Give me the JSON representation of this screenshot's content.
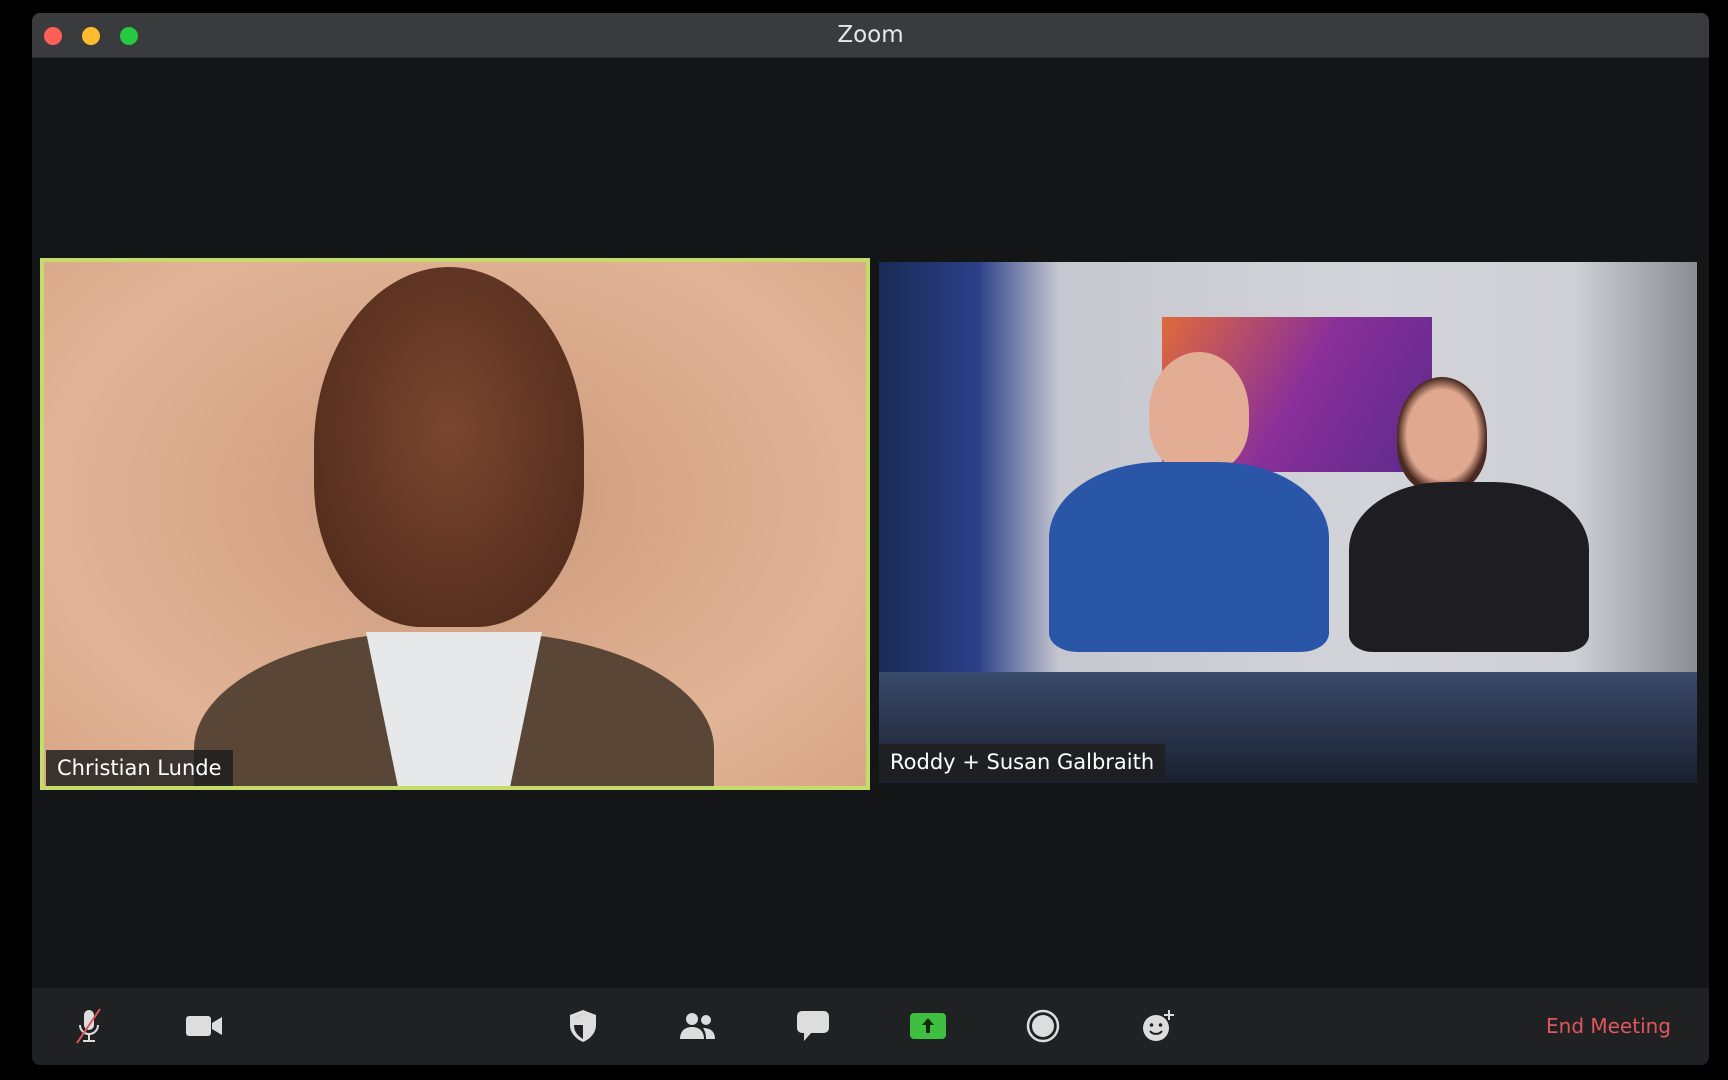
{
  "window": {
    "title": "Zoom"
  },
  "participants": [
    {
      "name": "Christian Lunde",
      "active_speaker": true
    },
    {
      "name": "Roddy + Susan Galbraith",
      "active_speaker": false
    }
  ],
  "toolbar": {
    "buttons": [
      {
        "icon": "microphone-muted-icon"
      },
      {
        "icon": "video-camera-icon"
      },
      {
        "icon": "security-shield-icon"
      },
      {
        "icon": "participants-icon"
      },
      {
        "icon": "chat-icon"
      },
      {
        "icon": "share-screen-icon"
      },
      {
        "icon": "record-icon"
      },
      {
        "icon": "reactions-icon"
      }
    ],
    "end_meeting_label": "End Meeting"
  },
  "colors": {
    "active_speaker_border": "#c3dc6a",
    "share_green": "#3fbf3f",
    "end_meeting": "#e0575b"
  }
}
